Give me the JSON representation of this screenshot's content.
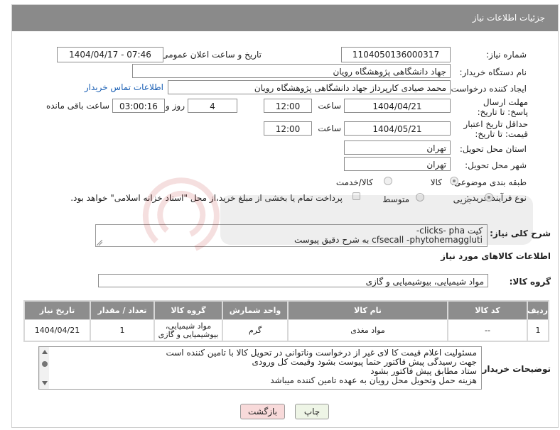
{
  "header": {
    "title": "جزئیات اطلاعات نیاز"
  },
  "fields": {
    "need_number_label": "شماره نیاز:",
    "need_number": "1104050136000317",
    "announce_label": "تاریخ و ساعت اعلان عمومی:",
    "announce_value": "1404/04/17 - 07:46",
    "buyer_org_label": "نام دستگاه خریدار:",
    "buyer_org": "جهاد دانشگاهی پژوهشگاه رویان",
    "creator_label": "ایجاد کننده درخواست:",
    "creator": "محمد صیادی کارپرداز جهاد دانشگاهی پژوهشگاه رویان",
    "contact_link": "اطلاعات تماس خریدار",
    "deadline_label": "مهلت ارسال پاسخ: تا تاریخ:",
    "deadline_date": "1404/04/21",
    "time_word": "ساعت",
    "deadline_time": "12:00",
    "days": "4",
    "days_word": "روز و",
    "remaining": "03:00:16",
    "remaining_word": "ساعت باقی مانده",
    "price_validity_label": "حداقل تاریخ اعتبار قیمت: تا تاریخ:",
    "price_validity_date": "1404/05/21",
    "price_validity_time": "12:00",
    "province_label": "استان محل تحویل:",
    "province": "تهران",
    "city_label": "شهر محل تحویل:",
    "city": "تهران",
    "category_label": "طبقه بندی موضوعی:",
    "category_goods": "کالا",
    "category_goods_service": "کالا/خدمت",
    "process_label": "نوع فرآیند خرید :",
    "process_partial": "جزیی",
    "process_medium": "متوسط",
    "payment_note": "پرداخت تمام یا بخشی از مبلغ خرید،از محل \"اسناد خزانه اسلامی\" خواهد بود."
  },
  "description": {
    "label": "شرح کلی نیاز:",
    "line1": "کیت clicks- pha-",
    "line2": "cfsecall -phytohemaggluti    به شرح دقیق پیوست"
  },
  "goods_info": {
    "title": "اطلاعات کالاهای مورد نیاز",
    "group_label": "گروه کالا:",
    "group_value": "مواد شیمیایی، بیوشیمیایی و  گازی"
  },
  "table": {
    "headers": [
      "ردیف",
      "کد کالا",
      "نام کالا",
      "واحد شمارش",
      "گروه کالا",
      "تعداد / مقدار",
      "تاریخ نیاز"
    ],
    "rows": [
      {
        "row": "1",
        "code": "--",
        "name": "مواد مغذی",
        "unit": "گرم",
        "group": "مواد شیمیایی، بیوشیمیایی و گازی",
        "qty": "1",
        "date": "1404/04/21"
      }
    ]
  },
  "buyer_notes": {
    "label": "توضیحات خریدار:",
    "lines": [
      "مسئولیت اعلام قیمت کا لای  غیر از درخواست وناتوانی در تحویل کالا با تامین کننده است",
      "جهت رسیدگی پیش فاکتور حتما پیوست بشود وقیمت کل ورودی",
      "ستاد مطابق پیش فاکتور بشود",
      "هزینه حمل وتحویل محل رویان به عهده تامین کننده میباشد"
    ]
  },
  "buttons": {
    "print": "چاپ",
    "back": "بازگشت"
  },
  "colors": {
    "header": "#8a8a8a",
    "back_button": "#f8dada",
    "print_button": "#eef5e6",
    "link": "#1a5fb4"
  }
}
